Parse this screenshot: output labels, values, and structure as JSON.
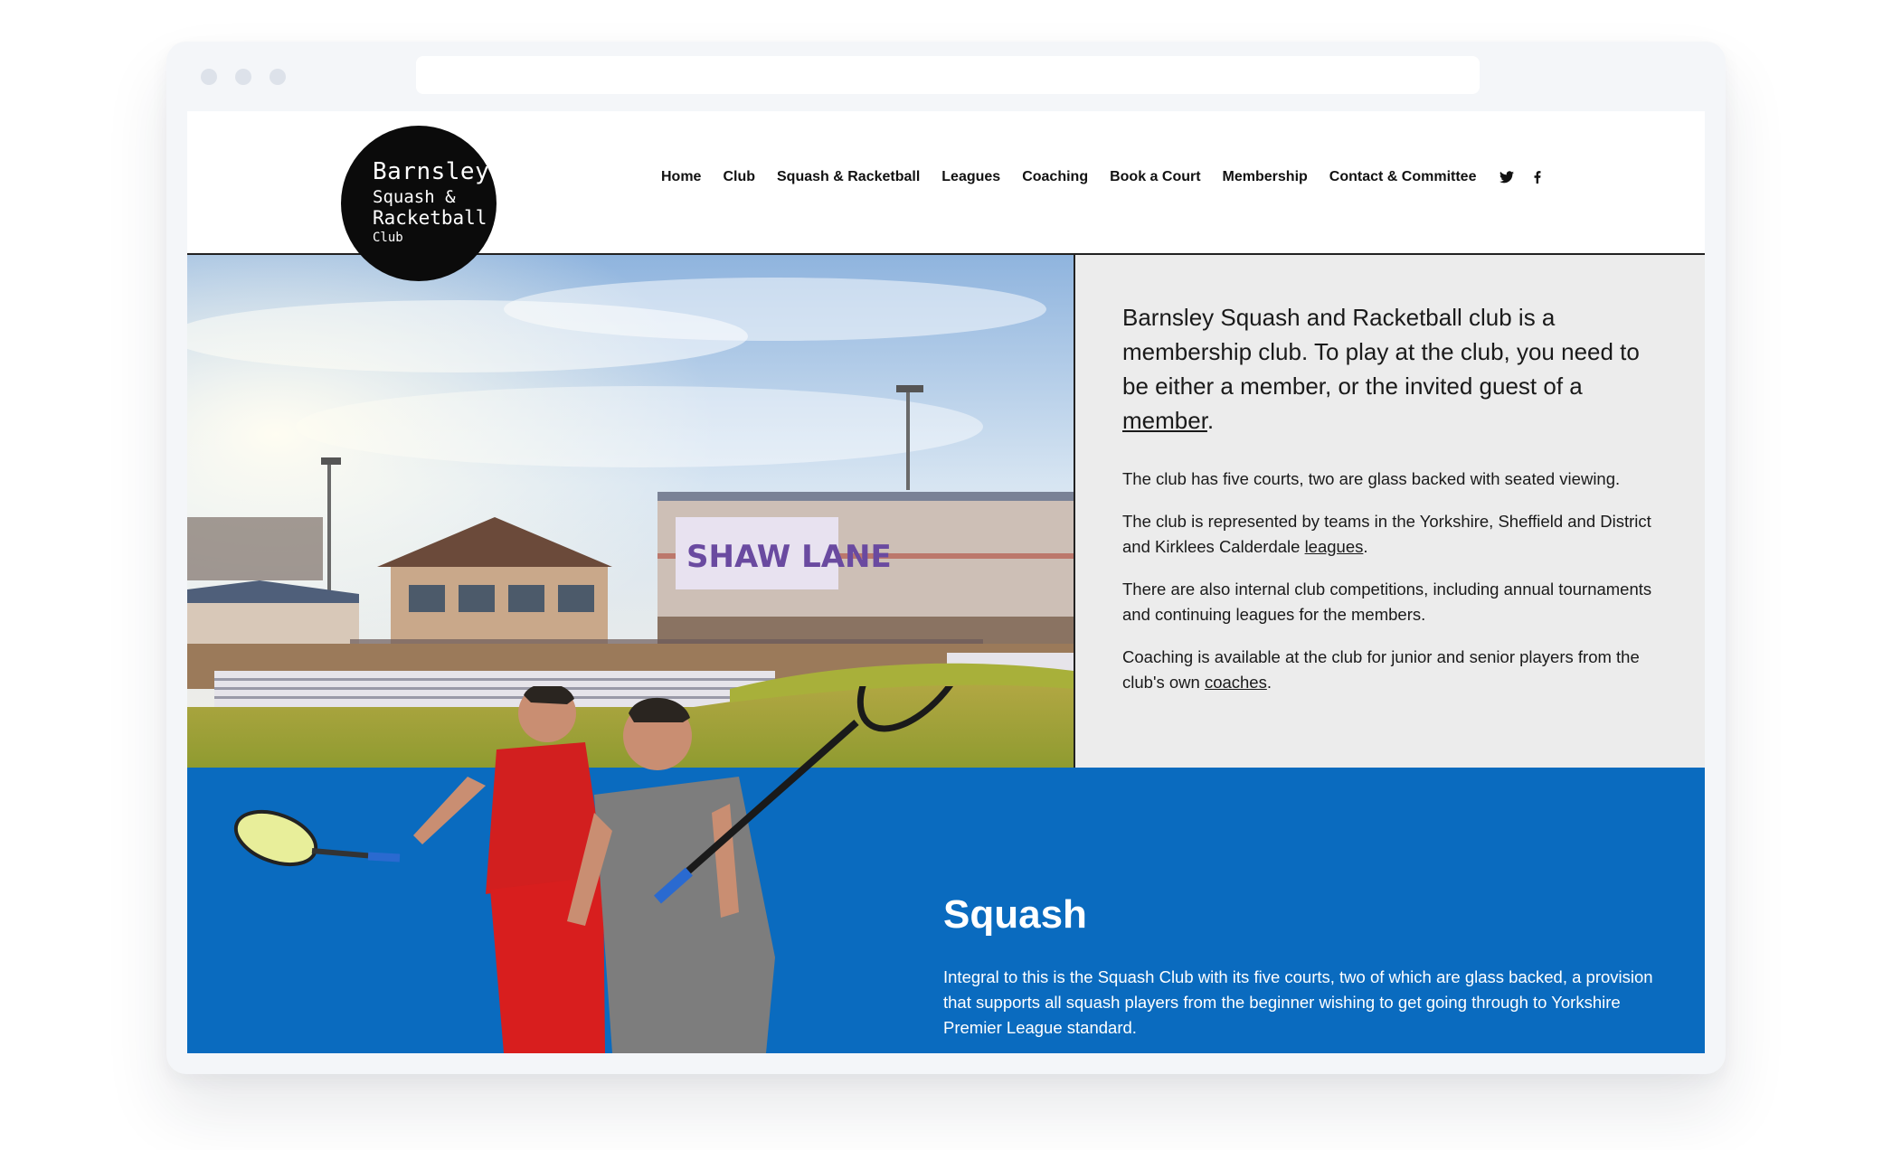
{
  "logo": {
    "line1": "Barnsley",
    "line2": "Squash &",
    "line3": "Racketball",
    "line4": "Club"
  },
  "nav": {
    "items": [
      "Home",
      "Club",
      "Squash & Racketball",
      "Leagues",
      "Coaching",
      "Book a Court",
      "Membership",
      "Contact & Committee"
    ],
    "social": [
      "twitter-icon",
      "facebook-icon"
    ]
  },
  "hero": {
    "photo_sign": "SHAW LANE"
  },
  "intro": {
    "lead_before": "Barnsley Squash and Racketball club is a membership club. To play at the club, you need to be either a member, or the invited guest of a ",
    "lead_link": "member",
    "lead_after": ".",
    "p1": "The club has five courts, two are glass backed with seated viewing.",
    "p2_before": "The club is represented by teams in the Yorkshire, Sheffield and District and Kirklees Calderdale ",
    "p2_link": "leagues",
    "p2_after": ".",
    "p3": "There are also internal club competitions, including annual tournaments and continuing leagues for the members.",
    "p4_before": "Coaching is available at the club for junior and senior players from the club's own ",
    "p4_link": "coaches",
    "p4_after": "."
  },
  "squash": {
    "title": "Squash",
    "text": "Integral to this is the Squash Club with its five courts, two of which are glass backed, a provision that supports all squash players from the beginner wishing to get going through to Yorkshire Premier League standard."
  },
  "colors": {
    "band_blue": "#0a6bbf",
    "intro_bg": "#ececec",
    "logo_bg": "#0b0b0b"
  }
}
